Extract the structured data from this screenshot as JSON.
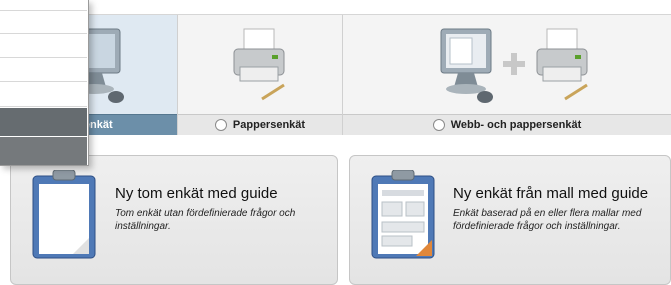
{
  "survey_types": {
    "web_label": "ebbenkät",
    "paper_label": "Pappersenkät",
    "both_label": "Webb- och pappersenkät"
  },
  "cards": [
    {
      "title": "Ny tom enkät med guide",
      "description": "Tom enkät utan fördefinierade frågor och inställningar."
    },
    {
      "title": "Ny enkät från mall med guide",
      "description": "Enkät baserad på en eller flera mallar med fördefinierade frågor och inställningar."
    }
  ],
  "colors": {
    "selected_bar": "#6c8fa9",
    "selected_panel": "#dfe9f2",
    "menu_dark": "#666c70"
  },
  "icons": [
    "monitor-icon",
    "printer-icon",
    "plus-icon",
    "clipboard-icon",
    "template-clipboard-icon"
  ]
}
